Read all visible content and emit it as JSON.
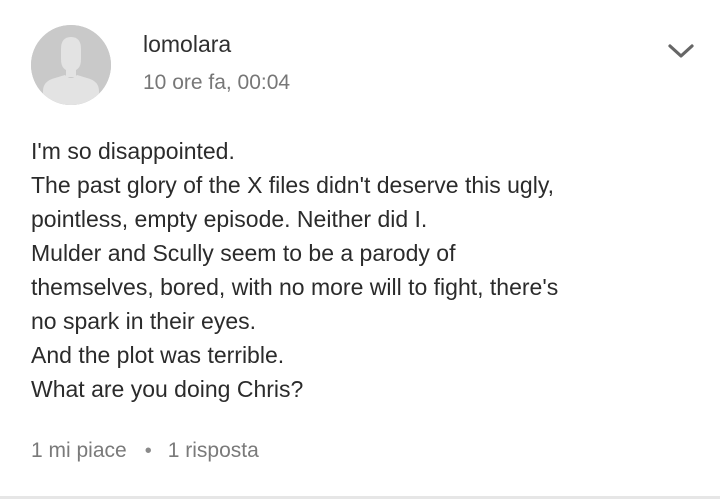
{
  "comment": {
    "author": "lomolara",
    "timestamp": "10 ore fa, 00:04",
    "more_icon": "chevron-down-icon",
    "avatar_icon": "default-user-silhouette",
    "body_lines": [
      "I'm so disappointed.",
      "The past glory of the X files didn't deserve this ugly,",
      "pointless, empty episode. Neither did I.",
      "Mulder and Scully seem to be a parody of",
      "themselves, bored, with no more will to fight, there's",
      "no spark in their eyes.",
      "And the plot was terrible.",
      "What are you doing Chris?"
    ],
    "likes_label": "1 mi piace",
    "separator": "•",
    "replies_label": "1 risposta"
  },
  "colors": {
    "text_primary": "#2b2b2b",
    "text_secondary": "#777777",
    "avatar_bg": "#c9c9c9",
    "avatar_fg": "#e3e3e3",
    "chevron": "#666666"
  }
}
